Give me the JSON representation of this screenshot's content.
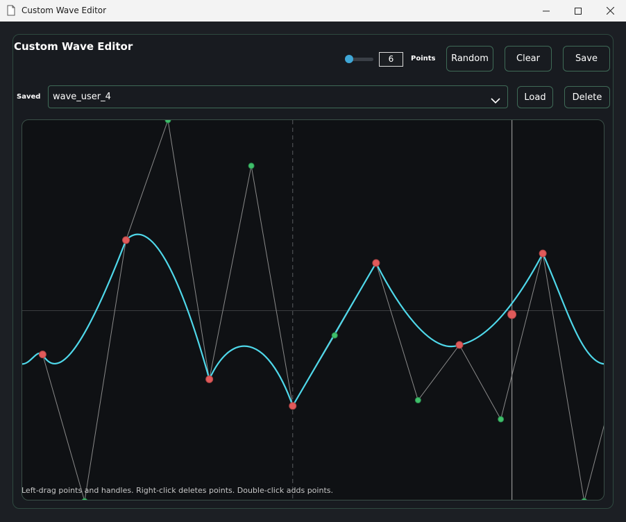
{
  "window": {
    "title": "Custom Wave Editor"
  },
  "app": {
    "title": "Custom Wave Editor",
    "points_value": "6",
    "points_label": "Points",
    "slider_fraction": 0.1,
    "buttons": {
      "random": "Random",
      "clear": "Clear",
      "save": "Save",
      "load": "Load",
      "delete": "Delete"
    },
    "saved_label": "Saved",
    "saved_selected": "wave_user_4"
  },
  "hint": "Left-drag points and handles. Right-click deletes points. Double-click adds points.",
  "colors": {
    "curve": "#4fd8ea",
    "anchor": "#e05a5a",
    "handle": "#3fbf6a",
    "guide": "#8a8a8a",
    "accent": "#3fa7d6",
    "border": "#3f6b57"
  },
  "chart_data": {
    "type": "line",
    "xlim": [
      0,
      1
    ],
    "ylim": [
      -1,
      1
    ],
    "anchors": [
      {
        "x": 0.035,
        "y": -0.23
      },
      {
        "x": 0.178,
        "y": 0.37
      },
      {
        "x": 0.321,
        "y": -0.36
      },
      {
        "x": 0.464,
        "y": -0.5
      },
      {
        "x": 0.607,
        "y": 0.25
      },
      {
        "x": 0.75,
        "y": -0.18
      },
      {
        "x": 0.893,
        "y": 0.3
      }
    ],
    "handles": [
      {
        "x": 0.107,
        "y": -1.0
      },
      {
        "x": 0.25,
        "y": 1.0
      },
      {
        "x": 0.393,
        "y": 0.76
      },
      {
        "x": 0.536,
        "y": -0.13
      },
      {
        "x": 0.679,
        "y": -0.47
      },
      {
        "x": 0.821,
        "y": -0.57
      },
      {
        "x": 0.964,
        "y": -1.0
      }
    ],
    "playhead_x": 0.84,
    "playhead_y": -0.02,
    "center_x": 0.464
  }
}
